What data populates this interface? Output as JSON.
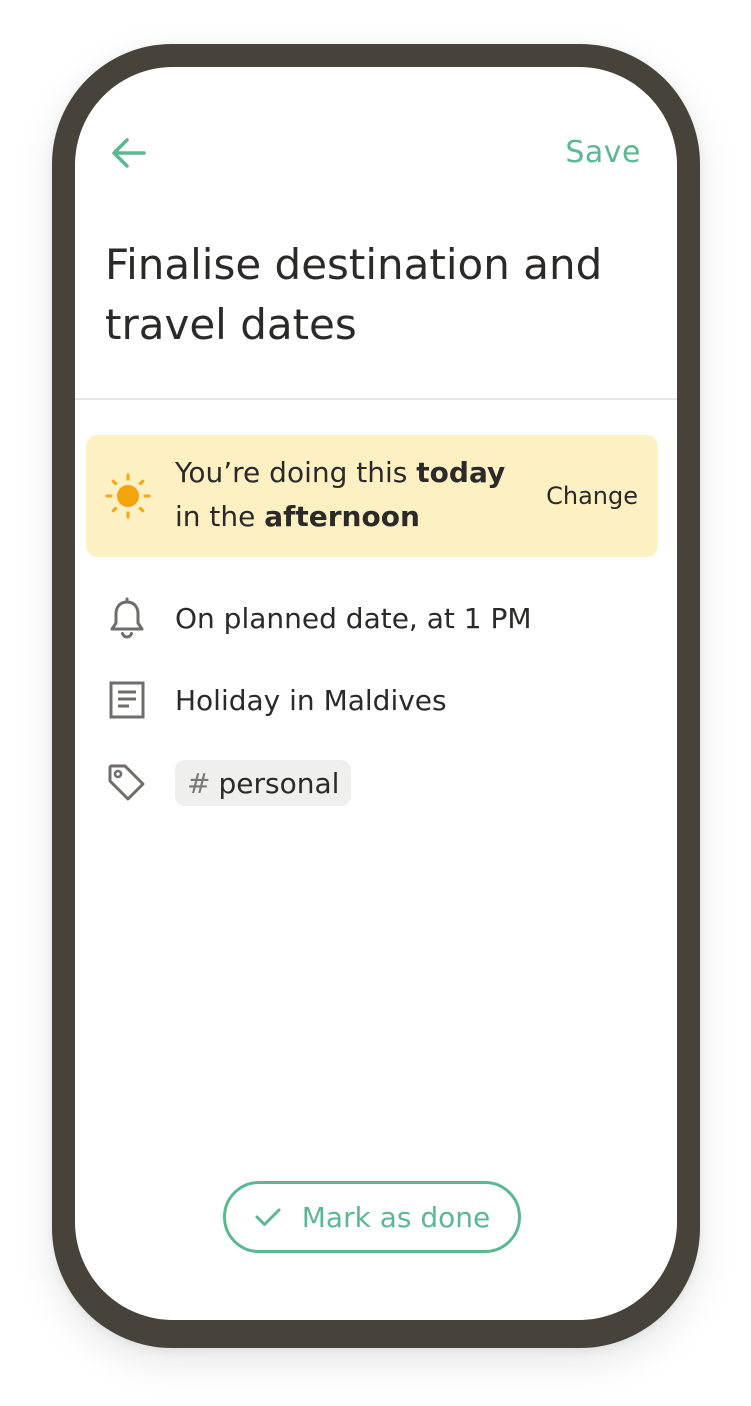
{
  "header": {
    "back_icon": "arrow-left-icon",
    "save_label": "Save"
  },
  "task": {
    "title": "Finalise destination and travel dates"
  },
  "schedule": {
    "icon": "sun-icon",
    "text_prefix": "You’re doing this ",
    "day": "today",
    "text_middle": "in the ",
    "time_of_day": "afternoon",
    "change_label": "Change"
  },
  "details": {
    "reminder": {
      "icon": "bell-icon",
      "text": "On planned date, at 1 PM"
    },
    "project": {
      "icon": "note-icon",
      "text": "Holiday in Maldives"
    },
    "tag": {
      "icon": "tag-icon",
      "hash": "#",
      "label": "personal"
    }
  },
  "footer": {
    "check_icon": "check-icon",
    "mark_done_label": "Mark as done"
  },
  "colors": {
    "accent": "#5cb893",
    "banner_bg": "#fdf0c2",
    "sun": "#f5a40f",
    "frame": "#47433b",
    "text": "#2b2a28"
  }
}
